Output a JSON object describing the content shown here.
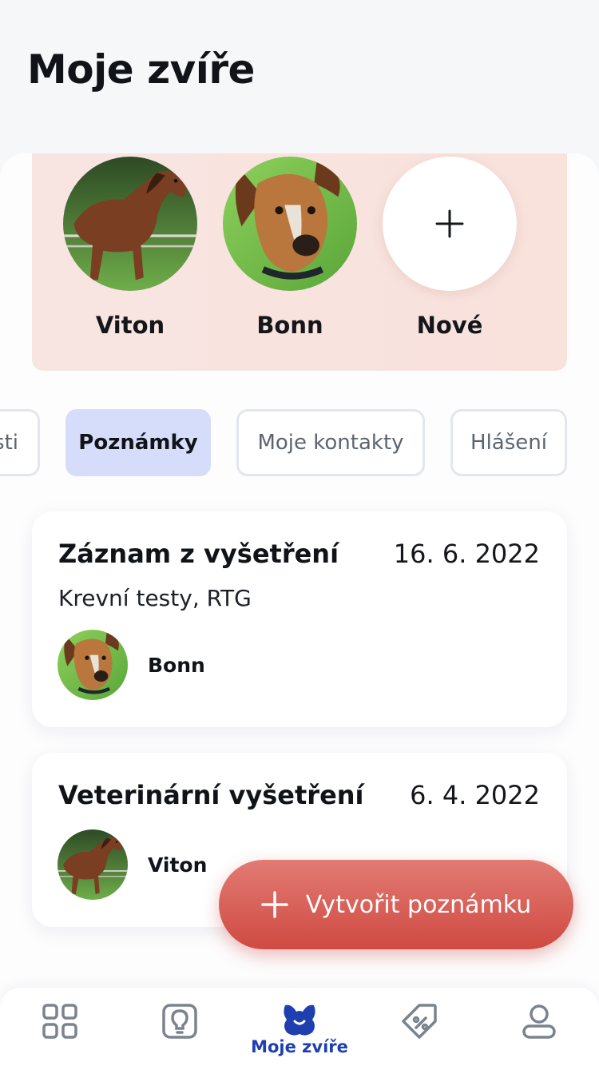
{
  "header": {
    "title": "Moje zvíře"
  },
  "pets": [
    {
      "name": "Viton"
    },
    {
      "name": "Bonn"
    }
  ],
  "add_pet": {
    "label": "Nové"
  },
  "tabs": [
    {
      "label": "sti"
    },
    {
      "label": "Poznámky",
      "active": true
    },
    {
      "label": "Moje kontakty"
    },
    {
      "label": "Hlášení"
    }
  ],
  "notes": [
    {
      "title": "Záznam z vyšetření",
      "date": "16. 6. 2022",
      "subtitle": "Krevní testy, RTG",
      "pet": "Bonn"
    },
    {
      "title": "Veterinární vyšetření",
      "date": "6. 4. 2022",
      "pet": "Viton"
    }
  ],
  "fab": {
    "label": "Vytvořit poznámku"
  },
  "bottom_nav": {
    "items": [
      {
        "icon": "grid-icon"
      },
      {
        "icon": "lightbulb-icon"
      },
      {
        "icon": "pet-icon",
        "label": "Moje zvíře",
        "active": true
      },
      {
        "icon": "discount-tag-icon"
      },
      {
        "icon": "profile-icon"
      }
    ]
  },
  "colors": {
    "accent": "#1f3fb0",
    "fab": "#d9605a",
    "active_tab": "#d5ddfb",
    "panel": "#f8e4e1"
  }
}
